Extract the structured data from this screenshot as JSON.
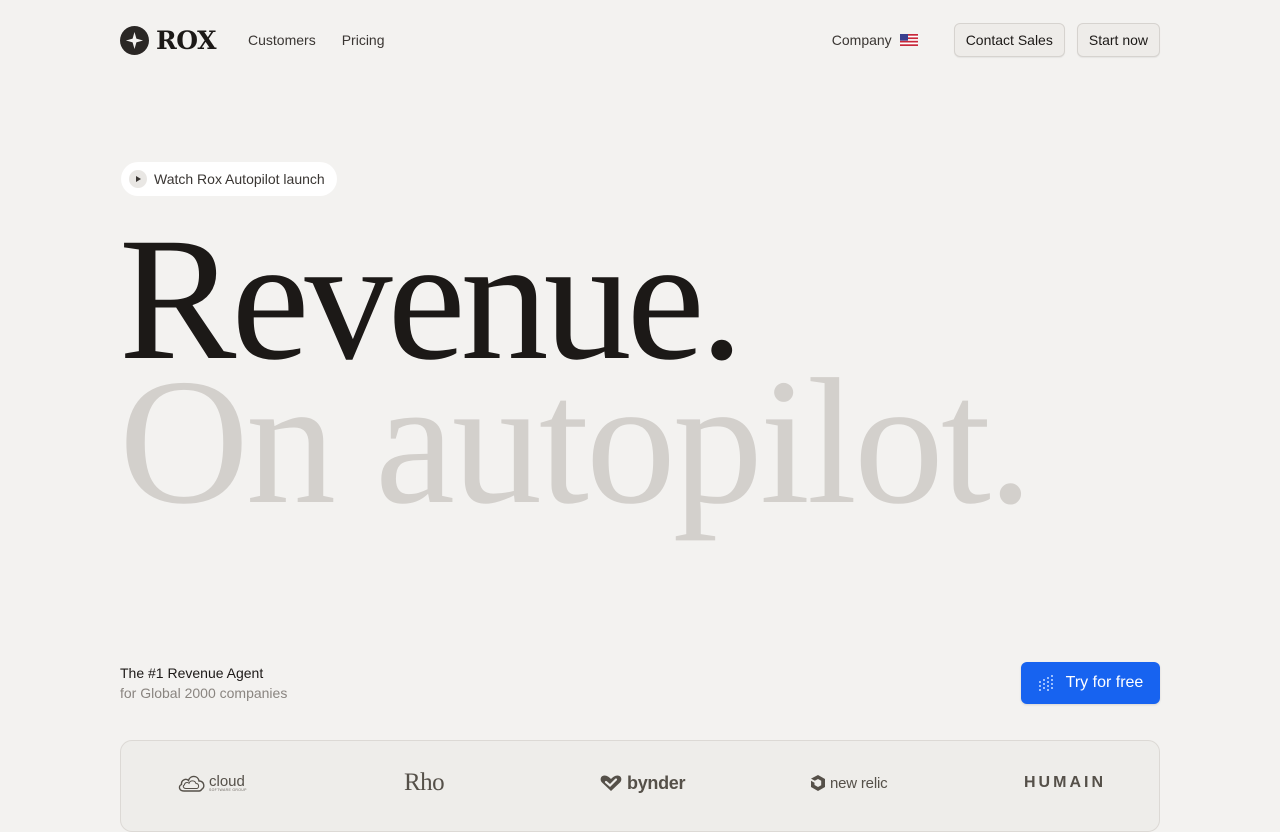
{
  "nav": {
    "brand": "ROX",
    "links": [
      {
        "label": "Customers"
      },
      {
        "label": "Pricing"
      }
    ],
    "company_label": "Company",
    "contact_label": "Contact Sales",
    "start_label": "Start now"
  },
  "hero": {
    "watch_label": "Watch Rox Autopilot launch",
    "headline_line1": "Revenue.",
    "headline_line2": "On autopilot."
  },
  "tagline": {
    "main": "The #1 Revenue Agent",
    "sub": "for Global 2000 companies"
  },
  "cta": {
    "label": "Try for free"
  },
  "customer_logos": {
    "cloud": "cloud",
    "cloud_sub": "SOFTWARE GROUP",
    "rho": "Rho",
    "bynder": "bynder",
    "new_relic": "new relic",
    "humain": "HUMAIN"
  },
  "colors": {
    "background": "#f3f2f0",
    "headline_dark": "#1c1917",
    "headline_light": "#d3d0cc",
    "primary_button": "#1763f0"
  },
  "icons": {
    "logo_mark": "four-point-star-icon",
    "flag": "us-flag-icon",
    "play": "play-icon",
    "cta": "dots-grid-icon"
  }
}
